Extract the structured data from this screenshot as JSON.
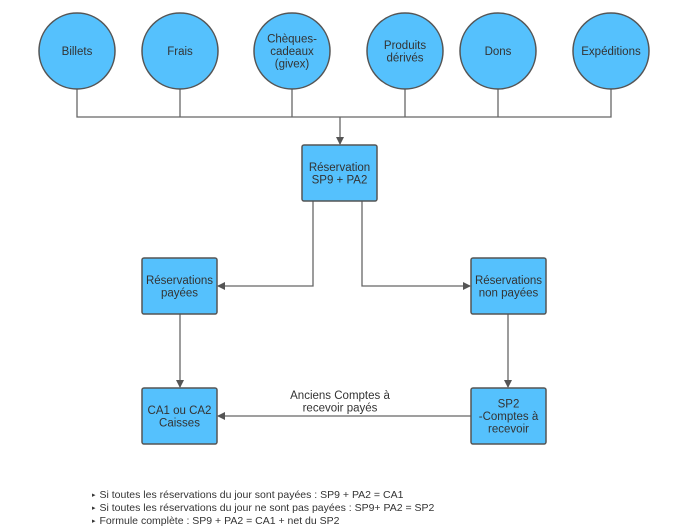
{
  "colors": {
    "node_fill": "#55C1FD",
    "stroke": "#555555",
    "text": "#333333"
  },
  "sources": [
    {
      "id": "billets",
      "lines": [
        "Billets"
      ]
    },
    {
      "id": "frais",
      "lines": [
        "Frais"
      ]
    },
    {
      "id": "cheques",
      "lines": [
        "Chèques-",
        "cadeaux",
        "(givex)"
      ]
    },
    {
      "id": "produits",
      "lines": [
        "Produits",
        "dérivés"
      ]
    },
    {
      "id": "dons",
      "lines": [
        "Dons"
      ]
    },
    {
      "id": "expeditions",
      "lines": [
        "Expéditions"
      ]
    }
  ],
  "boxes": {
    "reservation": [
      "Réservation",
      "SP9 + PA2"
    ],
    "payees": [
      "Réservations",
      "payées"
    ],
    "non_payees": [
      "Réservations",
      "non payées"
    ],
    "ca1": [
      "CA1 ou CA2",
      "Caisses"
    ],
    "sp2": [
      "SP2",
      "-Comptes à",
      "recevoir"
    ]
  },
  "edge_label": [
    "Anciens Comptes à",
    "recevoir payés"
  ],
  "notes": [
    "Si toutes les réservations du jour sont payées : SP9 + PA2 = CA1",
    "Si toutes les réservations du jour ne sont pas payées : SP9+ PA2 = SP2",
    "Formule complète : SP9 + PA2 = CA1 + net du SP2"
  ]
}
